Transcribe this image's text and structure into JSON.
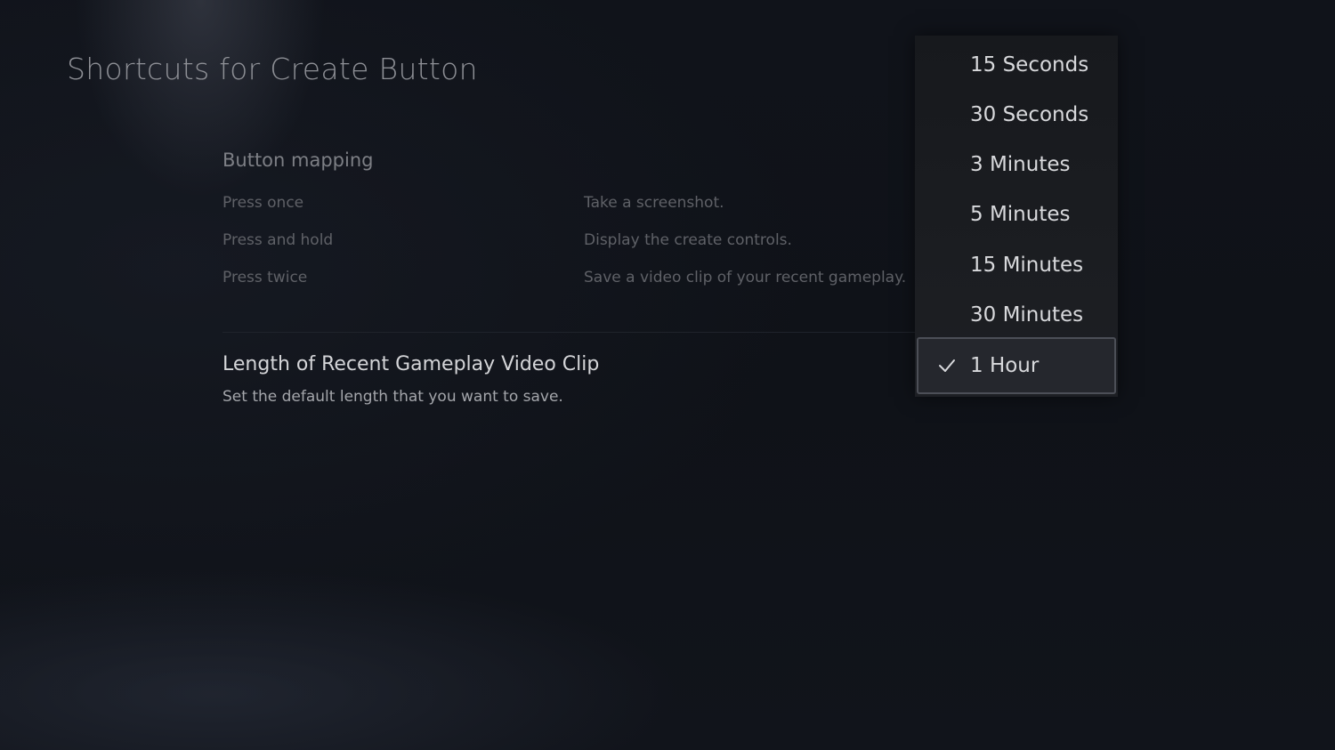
{
  "page": {
    "title": "Shortcuts for Create Button"
  },
  "button_mapping": {
    "heading": "Button mapping",
    "rows": [
      {
        "action": "Press once",
        "result": "Take a screenshot."
      },
      {
        "action": "Press and hold",
        "result": "Display the create controls."
      },
      {
        "action": "Press twice",
        "result": "Save a video clip of your recent gameplay."
      }
    ]
  },
  "setting": {
    "title": "Length of Recent Gameplay Video Clip",
    "description": "Set the default length that you want to save."
  },
  "dropdown": {
    "selected_index": 6,
    "selected_icon": "check-icon",
    "options": [
      {
        "label": "15 Seconds"
      },
      {
        "label": "30 Seconds"
      },
      {
        "label": "3 Minutes"
      },
      {
        "label": "5 Minutes"
      },
      {
        "label": "15 Minutes"
      },
      {
        "label": "30 Minutes"
      },
      {
        "label": "1 Hour"
      }
    ]
  }
}
